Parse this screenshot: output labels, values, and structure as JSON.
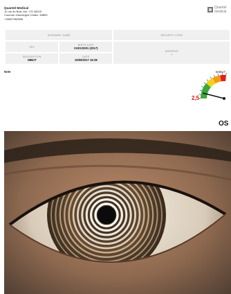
{
  "company": {
    "name": "Quantel Medical",
    "address1": "11 rue du Bois Joli - CS 40015",
    "address2": "Cournon d'Auvergne Cedex, 63800",
    "phone": "+33607952988"
  },
  "logo": {
    "line1": "Quantel",
    "line2": "medical"
  },
  "patient": {
    "surname_label": "SURNAME, NAME",
    "surname_value": "",
    "security_label": "SECURITY CODE",
    "security_value": "",
    "sex_label": "SEX",
    "sex_value": "",
    "birth_label": "BIRTH DATE",
    "birth_value": "01/01/2001 (2017)",
    "address_label": "ADDRESS",
    "address_value": "-",
    "description_label": "DESCRIPTION",
    "description_value": "NIBUT",
    "date_label": "DATE",
    "date_value": "19/09/2017 16:28"
  },
  "note_label": "Note",
  "gauge": {
    "label": "NIBUT",
    "value": "2,5",
    "needle_fraction": 0.15
  },
  "eye_side": "OS",
  "colors": {
    "panel": "#f0f0f0",
    "gauge_red": "#e02020",
    "gauge_orange": "#f39c12",
    "gauge_yellow": "#f1d21a",
    "gauge_green": "#3aa83a"
  }
}
